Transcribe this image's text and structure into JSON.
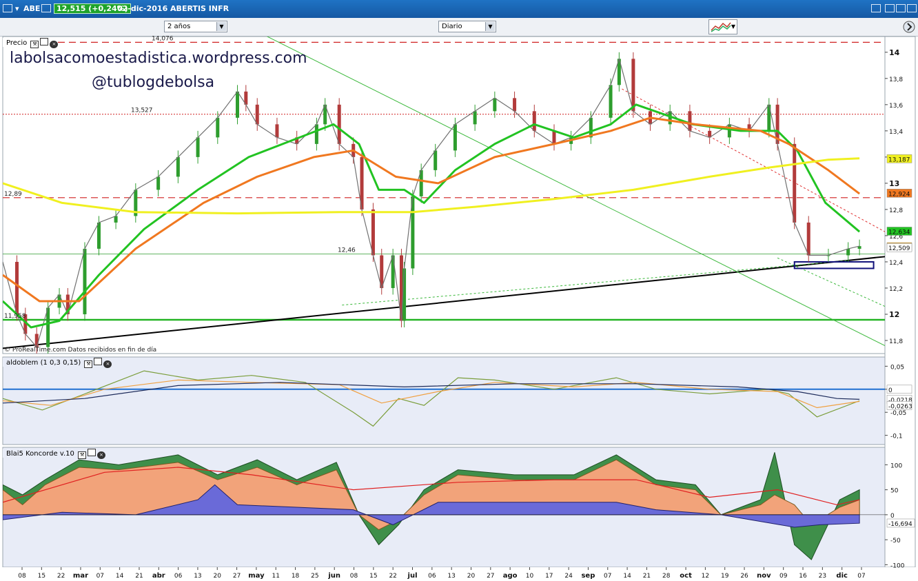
{
  "window": {
    "ticker": "ABE",
    "price_change": "12,515 (+0,24%)",
    "date_name": "02-dic-2016 ABERTIS INFR"
  },
  "toolbar": {
    "period": "2 años",
    "interval": "Diario"
  },
  "watermarks": {
    "blog": "labolsacomoestadistica.wordpress.com",
    "twitter": "@tublogdebolsa"
  },
  "source_note": "© ProRealTime.com  Datos recibidos en fin de día",
  "colors": {
    "up": "#2e9d2e",
    "down": "#b23b3b",
    "ma_fast": "#22c322",
    "ma_mid": "#f07820",
    "ma_slow": "#f0f020",
    "trend": "#000000",
    "blue_line": "#1f6fd1"
  },
  "chart_data": [
    {
      "type": "line",
      "panel": "price",
      "title": "Precio",
      "ylim": [
        11.7,
        14.12
      ],
      "y_ticks": [
        "14",
        "13,8",
        "13,6",
        "13,4",
        "13,2",
        "13",
        "12,8",
        "12,6",
        "12,4",
        "12,2",
        "12",
        "11,8"
      ],
      "x_ticks": [
        "08",
        "15",
        "22",
        "mar",
        "07",
        "14",
        "21",
        "abr",
        "06",
        "13",
        "20",
        "27",
        "may",
        "11",
        "18",
        "25",
        "jun",
        "08",
        "15",
        "22",
        "jul",
        "06",
        "13",
        "20",
        "27",
        "ago",
        "10",
        "17",
        "24",
        "sep",
        "07",
        "14",
        "21",
        "28",
        "oct",
        "12",
        "19",
        "26",
        "nov",
        "09",
        "16",
        "23",
        "dic",
        "07"
      ],
      "x_range": [
        "2016-02-03",
        "2016-12-11"
      ],
      "levels": [
        {
          "label": "14,076",
          "value": 14.076,
          "style": "dashed-red"
        },
        {
          "label": "13,527",
          "value": 13.527,
          "style": "dotted-red"
        },
        {
          "label": "12,89",
          "value": 12.89,
          "style": "dashed-red"
        },
        {
          "label": "12,46",
          "value": 12.46,
          "style": "thin-green"
        },
        {
          "label": "11,958",
          "value": 11.958,
          "style": "thick-green"
        }
      ],
      "value_badges": [
        {
          "label": "13,187",
          "value": 13.187,
          "color": "#f0f020"
        },
        {
          "label": "12,924",
          "value": 12.924,
          "color": "#f07820"
        },
        {
          "label": "12,634",
          "value": 12.634,
          "color": "#22c322"
        },
        {
          "label": "12,515",
          "value": 12.515,
          "color": "#f0a000"
        },
        {
          "label": "12,509",
          "value": 12.509,
          "color": "#ffffff"
        }
      ],
      "trendlines": [
        {
          "from": [
            "2016-02-03",
            11.74
          ],
          "to": [
            "2016-12-11",
            12.44
          ],
          "color": "black"
        },
        {
          "from": [
            "2016-05-01",
            14.18
          ],
          "to": [
            "2016-12-11",
            11.76
          ],
          "color": "green"
        },
        {
          "from": [
            "2016-06-02",
            12.07
          ],
          "to": [
            "2016-11-28",
            12.41
          ],
          "color": "green-dotted"
        },
        {
          "from": [
            "2016-09-09",
            13.72
          ],
          "to": [
            "2016-12-11",
            12.63
          ],
          "color": "red-dotted"
        },
        {
          "from": [
            "2016-11-03",
            12.43
          ],
          "to": [
            "2016-12-11",
            12.06
          ],
          "color": "green-dotted"
        }
      ],
      "box": {
        "from": [
          "2016-11-09",
          12.35
        ],
        "to": [
          "2016-12-07",
          12.4
        ]
      },
      "series": [
        {
          "name": "close",
          "dates": [
            "2016-02-03",
            "2016-02-08",
            "2016-02-11",
            "2016-02-15",
            "2016-02-19",
            "2016-02-23",
            "2016-02-26",
            "2016-03-03",
            "2016-03-08",
            "2016-03-14",
            "2016-03-21",
            "2016-03-29",
            "2016-04-05",
            "2016-04-12",
            "2016-04-19",
            "2016-04-26",
            "2016-04-29",
            "2016-05-03",
            "2016-05-10",
            "2016-05-17",
            "2016-05-24",
            "2016-05-27",
            "2016-06-01",
            "2016-06-06",
            "2016-06-09",
            "2016-06-13",
            "2016-06-16",
            "2016-06-20",
            "2016-06-23",
            "2016-06-24",
            "2016-06-27",
            "2016-06-30",
            "2016-07-05",
            "2016-07-12",
            "2016-07-19",
            "2016-07-26",
            "2016-08-02",
            "2016-08-09",
            "2016-08-16",
            "2016-08-22",
            "2016-08-29",
            "2016-09-05",
            "2016-09-08",
            "2016-09-13",
            "2016-09-19",
            "2016-09-26",
            "2016-10-03",
            "2016-10-10",
            "2016-10-17",
            "2016-10-24",
            "2016-10-31",
            "2016-11-03",
            "2016-11-09",
            "2016-11-14",
            "2016-11-21",
            "2016-11-28",
            "2016-12-02"
          ],
          "values": [
            12.4,
            12.0,
            11.85,
            11.75,
            12.05,
            12.15,
            12.0,
            12.5,
            12.7,
            12.75,
            12.95,
            13.05,
            13.2,
            13.35,
            13.5,
            13.7,
            13.6,
            13.45,
            13.35,
            13.3,
            13.45,
            13.6,
            13.3,
            13.2,
            12.8,
            12.45,
            12.2,
            12.45,
            11.95,
            12.35,
            12.9,
            13.1,
            13.25,
            13.45,
            13.55,
            13.65,
            13.55,
            13.4,
            13.3,
            13.35,
            13.5,
            13.75,
            13.95,
            13.55,
            13.45,
            13.55,
            13.4,
            13.35,
            13.45,
            13.4,
            13.6,
            13.3,
            12.7,
            12.45,
            12.45,
            12.5,
            12.52
          ]
        },
        {
          "name": "ma_fast",
          "dates": [
            "2016-02-03",
            "2016-02-13",
            "2016-02-23",
            "2016-03-08",
            "2016-03-24",
            "2016-04-12",
            "2016-04-30",
            "2016-05-18",
            "2016-05-30",
            "2016-06-08",
            "2016-06-15",
            "2016-06-24",
            "2016-07-01",
            "2016-07-12",
            "2016-07-26",
            "2016-08-09",
            "2016-08-23",
            "2016-09-05",
            "2016-09-14",
            "2016-10-04",
            "2016-10-21",
            "2016-11-03",
            "2016-11-10",
            "2016-11-20",
            "2016-12-02"
          ],
          "values": [
            12.1,
            11.9,
            11.95,
            12.3,
            12.65,
            12.95,
            13.2,
            13.35,
            13.45,
            13.3,
            12.95,
            12.95,
            12.85,
            13.1,
            13.3,
            13.45,
            13.35,
            13.45,
            13.6,
            13.45,
            13.4,
            13.4,
            13.25,
            12.85,
            12.63
          ]
        },
        {
          "name": "ma_mid",
          "dates": [
            "2016-02-03",
            "2016-02-16",
            "2016-03-01",
            "2016-03-21",
            "2016-04-14",
            "2016-05-03",
            "2016-05-23",
            "2016-06-06",
            "2016-06-21",
            "2016-07-06",
            "2016-07-26",
            "2016-08-16",
            "2016-09-05",
            "2016-09-19",
            "2016-10-05",
            "2016-10-28",
            "2016-11-07",
            "2016-11-21",
            "2016-12-02"
          ],
          "values": [
            12.3,
            12.1,
            12.1,
            12.5,
            12.85,
            13.05,
            13.2,
            13.25,
            13.05,
            13.0,
            13.2,
            13.3,
            13.4,
            13.5,
            13.45,
            13.4,
            13.3,
            13.1,
            12.92
          ]
        },
        {
          "name": "ma_slow",
          "dates": [
            "2016-02-03",
            "2016-02-24",
            "2016-03-21",
            "2016-04-26",
            "2016-06-01",
            "2016-06-27",
            "2016-07-19",
            "2016-08-16",
            "2016-09-13",
            "2016-10-10",
            "2016-10-31",
            "2016-11-21",
            "2016-12-02"
          ],
          "values": [
            13.0,
            12.85,
            12.78,
            12.77,
            12.78,
            12.78,
            12.82,
            12.88,
            12.95,
            13.05,
            13.12,
            13.18,
            13.19
          ]
        }
      ]
    },
    {
      "type": "line",
      "panel": "oscillator",
      "title": "aldoblem (1 0,3 0,15)",
      "ylim": [
        -0.12,
        0.07
      ],
      "y_ticks": [
        "0,05",
        "0",
        "-0,05",
        "-0,1"
      ],
      "value_badges": [
        {
          "label": "0",
          "value": 0
        },
        {
          "label": "-0,0218",
          "value": -0.0218
        },
        {
          "label": "-0,0263",
          "value": -0.0263
        }
      ],
      "series": [
        {
          "name": "fast",
          "dates": [
            "2016-02-03",
            "2016-02-17",
            "2016-03-03",
            "2016-03-24",
            "2016-04-12",
            "2016-05-01",
            "2016-05-20",
            "2016-06-06",
            "2016-06-13",
            "2016-06-22",
            "2016-07-01",
            "2016-07-13",
            "2016-07-26",
            "2016-08-16",
            "2016-09-07",
            "2016-09-21",
            "2016-10-10",
            "2016-10-31",
            "2016-11-07",
            "2016-11-17",
            "2016-12-02"
          ],
          "values": [
            -0.02,
            -0.045,
            -0.01,
            0.04,
            0.02,
            0.03,
            0.015,
            -0.05,
            -0.08,
            -0.02,
            -0.035,
            0.025,
            0.02,
            0.0,
            0.025,
            0.0,
            -0.01,
            0.0,
            -0.01,
            -0.06,
            -0.025
          ]
        },
        {
          "name": "mid",
          "dates": [
            "2016-02-03",
            "2016-02-20",
            "2016-03-10",
            "2016-04-05",
            "2016-05-01",
            "2016-06-01",
            "2016-06-16",
            "2016-07-06",
            "2016-07-26",
            "2016-08-23",
            "2016-09-14",
            "2016-10-10",
            "2016-11-03",
            "2016-11-17",
            "2016-12-02"
          ],
          "values": [
            -0.025,
            -0.035,
            0.0,
            0.02,
            0.015,
            0.01,
            -0.03,
            -0.005,
            0.015,
            0.005,
            0.015,
            0.0,
            -0.005,
            -0.04,
            -0.0263
          ]
        },
        {
          "name": "slow",
          "dates": [
            "2016-02-03",
            "2016-03-03",
            "2016-04-05",
            "2016-05-11",
            "2016-06-24",
            "2016-08-02",
            "2016-09-14",
            "2016-10-20",
            "2016-11-10",
            "2016-11-24",
            "2016-12-02"
          ],
          "values": [
            -0.03,
            -0.02,
            0.008,
            0.015,
            0.005,
            0.012,
            0.012,
            0.005,
            -0.005,
            -0.02,
            -0.0218
          ]
        }
      ]
    },
    {
      "type": "area",
      "panel": "koncorde",
      "title": "Blai5 Koncorde v.10",
      "ylim": [
        -105,
        135
      ],
      "y_ticks": [
        "100",
        "50",
        "0",
        "-50",
        "-100"
      ],
      "value_badges": [
        {
          "label": "-16,694",
          "value": -16.694
        }
      ],
      "series": [
        {
          "name": "green",
          "dates": [
            "2016-02-03",
            "2016-02-10",
            "2016-02-18",
            "2016-03-01",
            "2016-03-15",
            "2016-04-05",
            "2016-04-19",
            "2016-05-03",
            "2016-05-17",
            "2016-05-31",
            "2016-06-08",
            "2016-06-15",
            "2016-06-22",
            "2016-07-01",
            "2016-07-13",
            "2016-08-02",
            "2016-08-23",
            "2016-09-07",
            "2016-09-21",
            "2016-10-05",
            "2016-10-14",
            "2016-10-28",
            "2016-11-02",
            "2016-11-09",
            "2016-11-15",
            "2016-11-25",
            "2016-12-02"
          ],
          "values": [
            60,
            40,
            70,
            110,
            100,
            120,
            80,
            110,
            70,
            105,
            0,
            -60,
            -20,
            50,
            90,
            80,
            80,
            120,
            70,
            60,
            0,
            30,
            125,
            -60,
            -90,
            30,
            50
          ]
        },
        {
          "name": "orange",
          "dates": [
            "2016-02-03",
            "2016-02-10",
            "2016-02-18",
            "2016-03-01",
            "2016-03-15",
            "2016-04-05",
            "2016-04-19",
            "2016-05-03",
            "2016-05-17",
            "2016-05-31",
            "2016-06-08",
            "2016-06-15",
            "2016-06-22",
            "2016-07-01",
            "2016-07-13",
            "2016-08-02",
            "2016-08-23",
            "2016-09-07",
            "2016-09-21",
            "2016-10-05",
            "2016-10-14",
            "2016-10-28",
            "2016-11-02",
            "2016-11-09",
            "2016-11-15",
            "2016-11-25",
            "2016-12-02"
          ],
          "values": [
            50,
            20,
            60,
            95,
            90,
            105,
            70,
            95,
            60,
            90,
            0,
            -30,
            -10,
            40,
            80,
            70,
            70,
            110,
            60,
            50,
            0,
            20,
            40,
            20,
            -20,
            15,
            30
          ]
        },
        {
          "name": "blue",
          "dates": [
            "2016-02-03",
            "2016-02-24",
            "2016-03-21",
            "2016-04-12",
            "2016-04-18",
            "2016-04-26",
            "2016-05-17",
            "2016-06-06",
            "2016-06-20",
            "2016-07-06",
            "2016-08-02",
            "2016-09-07",
            "2016-09-21",
            "2016-10-14",
            "2016-11-09",
            "2016-11-18",
            "2016-12-02"
          ],
          "values": [
            -10,
            5,
            0,
            30,
            60,
            20,
            15,
            10,
            -20,
            25,
            25,
            25,
            10,
            0,
            -25,
            -20,
            -17
          ]
        },
        {
          "name": "red",
          "dates": [
            "2016-02-03",
            "2016-03-10",
            "2016-04-05",
            "2016-05-01",
            "2016-06-06",
            "2016-07-13",
            "2016-08-16",
            "2016-09-14",
            "2016-10-10",
            "2016-11-03",
            "2016-11-24",
            "2016-12-02"
          ],
          "values": [
            25,
            85,
            95,
            80,
            50,
            65,
            70,
            70,
            35,
            50,
            20,
            30
          ]
        }
      ]
    }
  ]
}
